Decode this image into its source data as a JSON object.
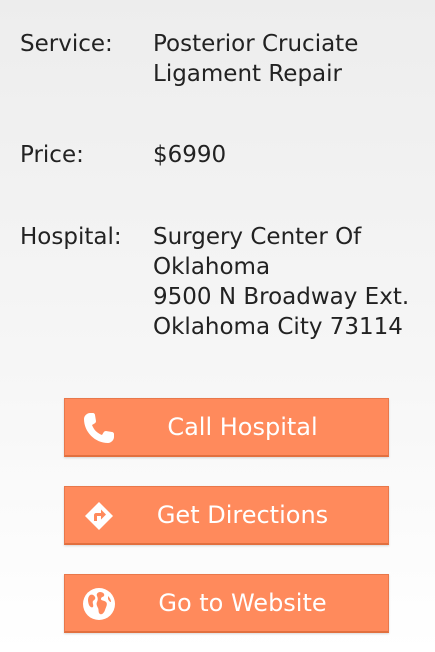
{
  "details": {
    "service": {
      "label": "Service:",
      "lines": [
        "Posterior Cruciate",
        "Ligament Repair"
      ]
    },
    "price": {
      "label": "Price:",
      "value": "$6990"
    },
    "hospital": {
      "label": "Hospital:",
      "lines": [
        "Surgery Center Of",
        "Oklahoma",
        "9500 N Broadway Ext.",
        "Oklahoma City 73114"
      ]
    }
  },
  "actions": {
    "call": {
      "label": "Call Hospital",
      "icon": "phone-icon"
    },
    "directions": {
      "label": "Get Directions",
      "icon": "directions-icon"
    },
    "website": {
      "label": "Go to Website",
      "icon": "globe-icon"
    }
  },
  "colors": {
    "button": "#ff8a5c",
    "button_text": "#ffffff",
    "text": "#222222"
  }
}
